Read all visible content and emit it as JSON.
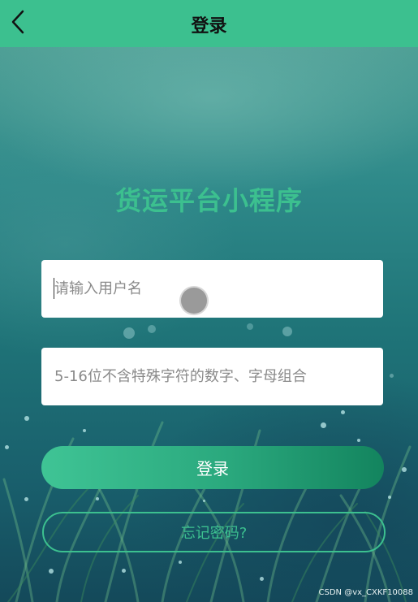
{
  "header": {
    "title": "登录",
    "back_icon": "chevron-left-icon"
  },
  "app": {
    "title": "货运平台小程序"
  },
  "form": {
    "username_placeholder": "请输入用户名",
    "username_value": "",
    "password_placeholder": "5-16位不含特殊字符的数字、字母组合",
    "password_value": ""
  },
  "actions": {
    "login_label": "登录",
    "forgot_label": "忘记密码?"
  },
  "watermark": "CSDN @vx_CXKF10088",
  "colors": {
    "brand_green": "#3cc08f",
    "login_gradient_end": "#13845e",
    "field_bg": "#ffffff"
  }
}
